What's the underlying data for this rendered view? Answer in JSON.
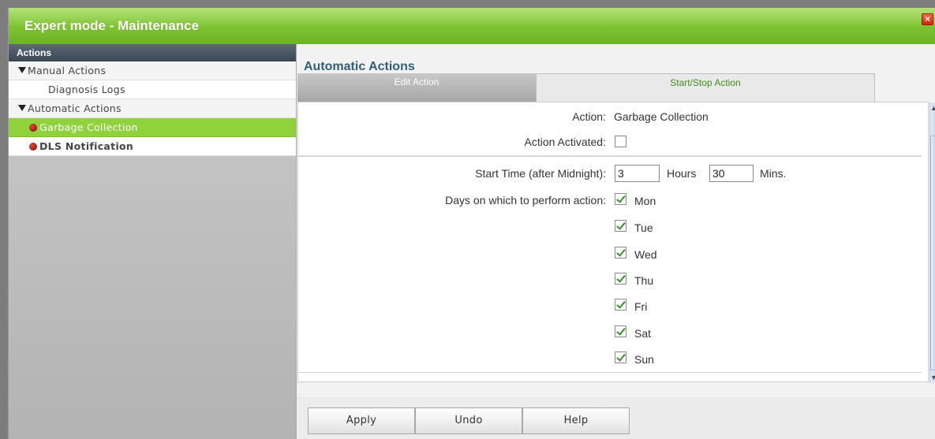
{
  "window": {
    "title": "Expert mode - Maintenance",
    "close_glyph": "×"
  },
  "sidebar": {
    "header": "Actions",
    "items": [
      {
        "label": "Manual Actions",
        "type": "group"
      },
      {
        "label": "Diagnosis Logs",
        "type": "sub"
      },
      {
        "label": "Automatic Actions",
        "type": "group"
      },
      {
        "label": "Garbage Collection",
        "type": "leaf",
        "active": true
      },
      {
        "label": "DLS Notification",
        "type": "leaf",
        "active": false
      }
    ]
  },
  "main": {
    "title": "Automatic Actions",
    "tabs": [
      {
        "label": "Edit Action",
        "active": true
      },
      {
        "label": "Start/Stop Action",
        "active": false
      }
    ],
    "form": {
      "action_label": "Action:",
      "action_value": "Garbage Collection",
      "activated_label": "Action Activated:",
      "activated": false,
      "start_time_label": "Start Time (after Midnight):",
      "hours_value": "3",
      "hours_unit": "Hours",
      "mins_value": "30",
      "mins_unit": "Mins.",
      "days_label": "Days on which to perform action:",
      "days": [
        {
          "label": "Mon",
          "checked": true
        },
        {
          "label": "Tue",
          "checked": true
        },
        {
          "label": "Wed",
          "checked": true
        },
        {
          "label": "Thu",
          "checked": true
        },
        {
          "label": "Fri",
          "checked": true
        },
        {
          "label": "Sat",
          "checked": true
        },
        {
          "label": "Sun",
          "checked": true
        }
      ]
    },
    "buttons": {
      "apply": "Apply",
      "undo": "Undo",
      "help": "Help"
    }
  },
  "colors": {
    "title_green": "#7dc230",
    "active_item": "#8fd23c",
    "section_title": "#2f5f7a",
    "tab_inactive_text": "#3d8f1b"
  }
}
